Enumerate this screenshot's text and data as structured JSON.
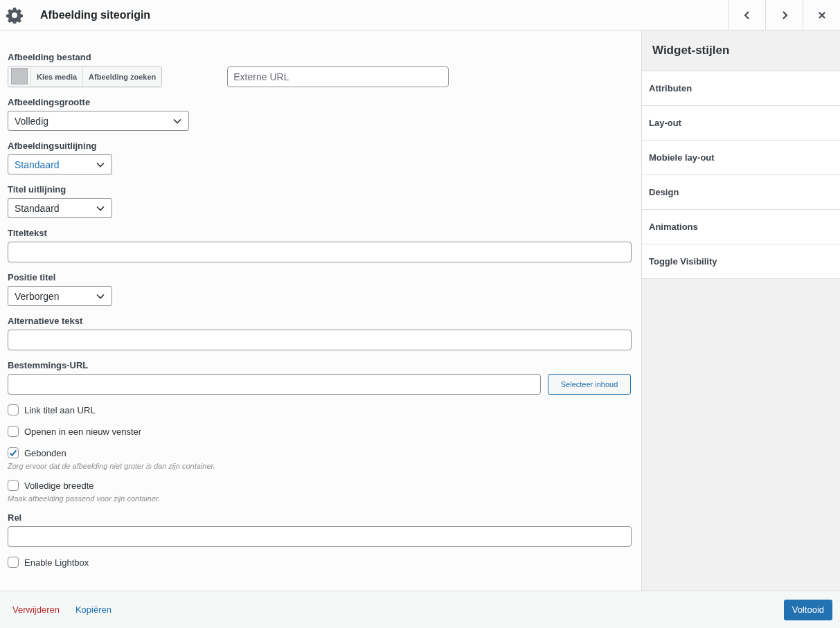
{
  "window": {
    "title": "Afbeelding siteorigin"
  },
  "fields": [
    {
      "kind": "media",
      "label": "Afbeelding bestand",
      "buttons": [
        "Kies media",
        "Afbeelding zoeken"
      ],
      "url_placeholder": "Externe URL"
    },
    {
      "kind": "wide-select",
      "label": "Afbeeldingsgrootte",
      "value": "Volledig",
      "highlighted": false
    },
    {
      "kind": "select",
      "label": "Afbeeldingsuitlijning",
      "value": "Standaard",
      "highlighted": true
    },
    {
      "kind": "select",
      "label": "Titel uitlijning",
      "value": "Standaard",
      "highlighted": false
    },
    {
      "kind": "text",
      "label": "Titeltekst"
    },
    {
      "kind": "select",
      "label": "Positie titel",
      "value": "Verborgen",
      "highlighted": false
    },
    {
      "kind": "text",
      "label": "Alternatieve tekst"
    },
    {
      "kind": "url",
      "label": "Bestemmings-URL",
      "button": "Selecteer inhoud"
    },
    {
      "kind": "checkbox",
      "label": "Link titel aan URL",
      "checked": false
    },
    {
      "kind": "checkbox",
      "label": "Openen in een nieuw venster",
      "checked": false
    },
    {
      "kind": "checkbox",
      "label": "Gebonden",
      "checked": true,
      "description": "Zorg ervoor dat de afbeelding niet groter is dan zijn container."
    },
    {
      "kind": "checkbox",
      "label": "Volledige breedte",
      "checked": false,
      "description": "Maak afbeelding passend voor zijn container."
    },
    {
      "kind": "text",
      "label": "Rel"
    },
    {
      "kind": "checkbox",
      "label": "Enable Lightbox",
      "checked": false
    }
  ],
  "sidebar": {
    "title": "Widget-stijlen",
    "items": [
      "Attributen",
      "Lay-out",
      "Mobiele lay-out",
      "Design",
      "Animations",
      "Toggle Visibility"
    ]
  },
  "footer": {
    "delete": "Verwijderen",
    "copy": "Kopiëren",
    "done": "Voltooid"
  }
}
